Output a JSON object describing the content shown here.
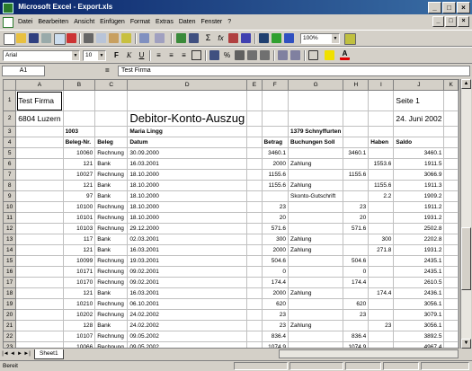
{
  "window": {
    "title": "Microsoft Excel - Export.xls",
    "controls": [
      "_",
      "□",
      "×"
    ]
  },
  "menu": {
    "items": [
      "Datei",
      "Bearbeiten",
      "Ansicht",
      "Einfügen",
      "Format",
      "Extras",
      "Daten",
      "Fenster",
      "?"
    ],
    "doc_controls": [
      "_",
      "□",
      "×"
    ]
  },
  "formatting": {
    "font": "Arial",
    "size": "10",
    "zoom": "100%"
  },
  "formula_bar": {
    "name_box": "A1",
    "equals": "=",
    "content": "Test Firma"
  },
  "columns": [
    "A",
    "B",
    "C",
    "D",
    "E",
    "F",
    "G",
    "H",
    "I",
    "J",
    "K"
  ],
  "rows": [
    {
      "n": "1",
      "cells": [
        "Test Firma",
        "",
        "",
        "",
        "",
        "",
        "",
        "",
        "",
        "Seite 1",
        ""
      ]
    },
    {
      "n": "2",
      "cells": [
        "6804 Luzern",
        "",
        "",
        "Debitor-Konto-Auszug",
        "",
        "",
        "",
        "",
        "",
        "24. Juni 2002",
        ""
      ]
    },
    {
      "n": "3",
      "cells": [
        "",
        "1003",
        "",
        "Maria Lingg",
        "",
        "",
        "1379 Schnyffurten",
        "",
        "",
        "",
        ""
      ]
    },
    {
      "n": "4",
      "cells": [
        "",
        "Beleg-Nr.",
        "Beleg",
        "Datum",
        "",
        "Betrag",
        "Buchungen Soll",
        "",
        "Haben",
        "Saldo",
        ""
      ]
    },
    {
      "n": "5",
      "cells": [
        "",
        "10060",
        "Rechnung",
        "30.09.2000",
        "",
        "3460.1",
        "",
        "3460.1",
        "",
        "3460.1",
        ""
      ]
    },
    {
      "n": "6",
      "cells": [
        "",
        "121",
        "Bank",
        "16.03.2001",
        "",
        "2000",
        "Zahlung",
        "",
        "1553.6",
        "1911.5",
        ""
      ]
    },
    {
      "n": "7",
      "cells": [
        "",
        "10027",
        "Rechnung",
        "18.10.2000",
        "",
        "1155.6",
        "",
        "1155.6",
        "",
        "3066.9",
        ""
      ]
    },
    {
      "n": "8",
      "cells": [
        "",
        "121",
        "Bank",
        "18.10.2000",
        "",
        "1155.6",
        "Zahlung",
        "",
        "1155.6",
        "1911.3",
        ""
      ]
    },
    {
      "n": "9",
      "cells": [
        "",
        "97",
        "Bank",
        "18.10.2000",
        "",
        "",
        "Skonto-Gutschrift",
        "",
        "2.2",
        "1909.2",
        ""
      ]
    },
    {
      "n": "10",
      "cells": [
        "",
        "10100",
        "Rechnung",
        "18.10.2000",
        "",
        "23",
        "",
        "23",
        "",
        "1911.2",
        ""
      ]
    },
    {
      "n": "11",
      "cells": [
        "",
        "10101",
        "Rechnung",
        "18.10.2000",
        "",
        "20",
        "",
        "20",
        "",
        "1931.2",
        ""
      ]
    },
    {
      "n": "12",
      "cells": [
        "",
        "10103",
        "Rechnung",
        "29.12.2000",
        "",
        "571.6",
        "",
        "571.6",
        "",
        "2502.8",
        ""
      ]
    },
    {
      "n": "13",
      "cells": [
        "",
        "117",
        "Bank",
        "02.03.2001",
        "",
        "300",
        "Zahlung",
        "",
        "300",
        "2202.8",
        ""
      ]
    },
    {
      "n": "14",
      "cells": [
        "",
        "121",
        "Bank",
        "16.03.2001",
        "",
        "2000",
        "Zahlung",
        "",
        "271.8",
        "1931.2",
        ""
      ]
    },
    {
      "n": "15",
      "cells": [
        "",
        "10099",
        "Rechnung",
        "19.03.2001",
        "",
        "504.6",
        "",
        "504.6",
        "",
        "2435.1",
        ""
      ]
    },
    {
      "n": "16",
      "cells": [
        "",
        "10171",
        "Rechnung",
        "09.02.2001",
        "",
        "0",
        "",
        "0",
        "",
        "2435.1",
        ""
      ]
    },
    {
      "n": "17",
      "cells": [
        "",
        "10170",
        "Rechnung",
        "09.02.2001",
        "",
        "174.4",
        "",
        "174.4",
        "",
        "2610.5",
        ""
      ]
    },
    {
      "n": "18",
      "cells": [
        "",
        "121",
        "Bank",
        "16.03.2001",
        "",
        "2000",
        "Zahlung",
        "",
        "174.4",
        "2436.1",
        ""
      ]
    },
    {
      "n": "19",
      "cells": [
        "",
        "10210",
        "Rechnung",
        "06.10.2001",
        "",
        "620",
        "",
        "620",
        "",
        "3056.1",
        ""
      ]
    },
    {
      "n": "20",
      "cells": [
        "",
        "10202",
        "Rechnung",
        "24.02.2002",
        "",
        "23",
        "",
        "23",
        "",
        "3079.1",
        ""
      ]
    },
    {
      "n": "21",
      "cells": [
        "",
        "128",
        "Bank",
        "24.02.2002",
        "",
        "23",
        "Zahlung",
        "",
        "23",
        "3056.1",
        ""
      ]
    },
    {
      "n": "22",
      "cells": [
        "",
        "10107",
        "Rechnung",
        "09.05.2002",
        "",
        "836.4",
        "",
        "836.4",
        "",
        "3892.5",
        ""
      ]
    },
    {
      "n": "23",
      "cells": [
        "",
        "10066",
        "Rechnung",
        "09.05.2002",
        "",
        "1074.9",
        "",
        "1074.9",
        "",
        "4967.4",
        ""
      ]
    }
  ],
  "sheet_tab": "Sheet1",
  "status": "Bereit",
  "nav_arrows": [
    "|◄",
    "◄",
    "►",
    "►|"
  ]
}
